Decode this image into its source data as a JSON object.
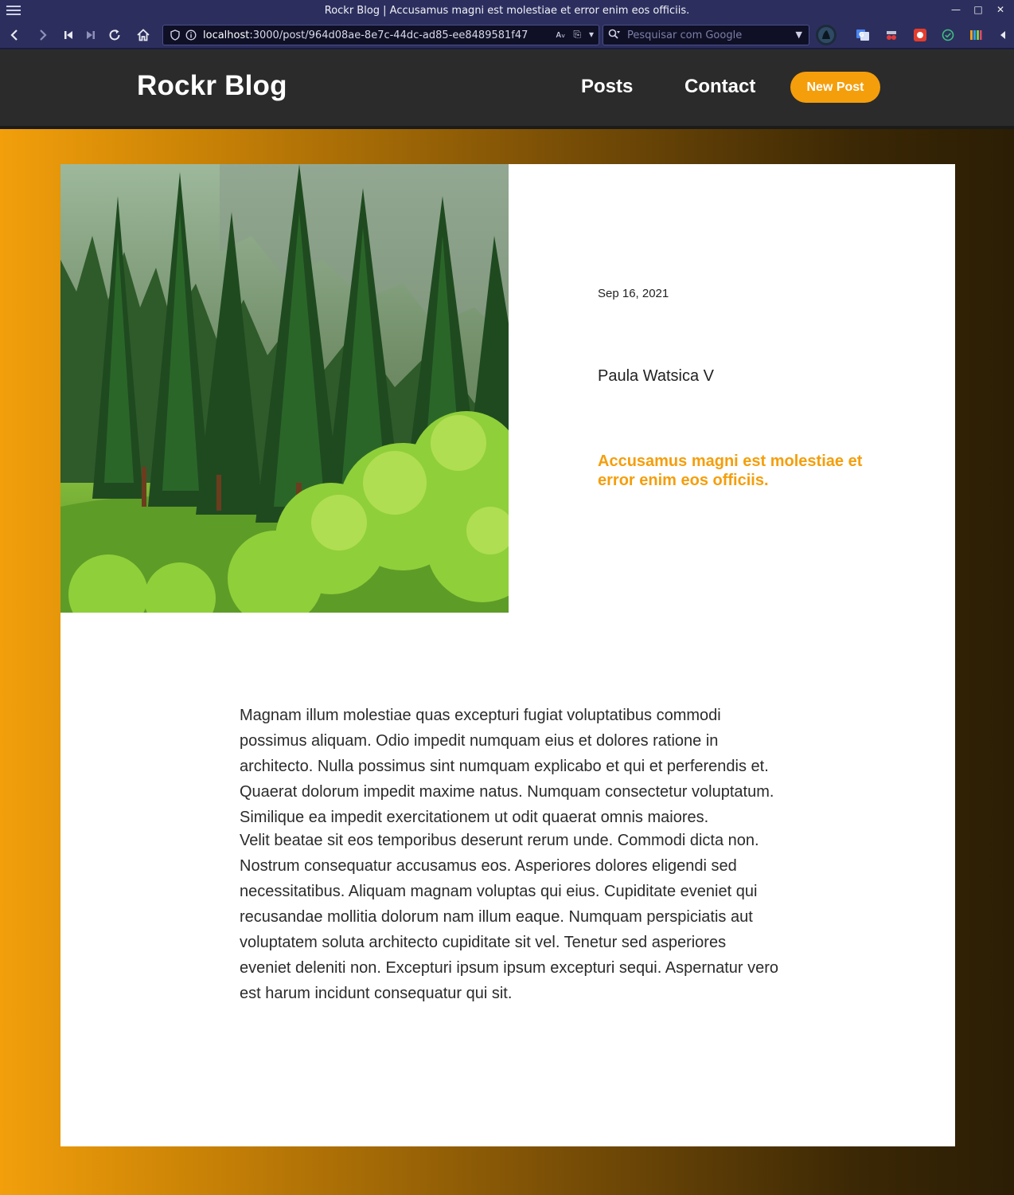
{
  "browser": {
    "window_title": "Rockr Blog | Accusamus magni est molestiae et error enim eos officiis.",
    "url_host": "localhost",
    "url_rest": ":3000/post/964d08ae-8e7c-44dc-ad85-ee8489581f47",
    "search_placeholder": "Pesquisar com Google",
    "window_controls": [
      "minimize-icon",
      "maximize-icon",
      "close-icon"
    ],
    "nav_icons": [
      "back-icon",
      "forward-icon",
      "first-page-icon",
      "last-page-icon",
      "reload-icon",
      "home-icon"
    ]
  },
  "site": {
    "brand": "Rockr Blog",
    "nav": {
      "posts": "Posts",
      "contact": "Contact",
      "new_post": "New Post"
    },
    "accent_color": "#f59e0b",
    "header_bg": "#2b2b2b"
  },
  "post": {
    "date": "Sep 16, 2021",
    "author": "Paula Watsica V",
    "title": "Accusamus magni est molestiae et error enim eos officiis.",
    "image_alt": "pine forest with green meadow",
    "paragraphs": [
      "Magnam illum molestiae quas excepturi fugiat voluptatibus commodi possimus aliquam. Odio impedit numquam eius et dolores ratione in architecto. Nulla possimus sint numquam explicabo et qui et perferendis et. Quaerat dolorum impedit maxime natus. Numquam consectetur voluptatum. Similique ea impedit exercitationem ut odit quaerat omnis maiores.",
      "Velit beatae sit eos temporibus deserunt rerum unde. Commodi dicta non. Nostrum consequatur accusamus eos. Asperiores dolores eligendi sed necessitatibus. Aliquam magnam voluptas qui eius. Cupiditate eveniet qui recusandae mollitia dolorum nam illum eaque. Numquam perspiciatis aut voluptatem soluta architecto cupiditate sit vel. Tenetur sed asperiores eveniet deleniti non. Excepturi ipsum ipsum excepturi sequi. Aspernatur vero est harum incidunt consequatur qui sit."
    ]
  }
}
